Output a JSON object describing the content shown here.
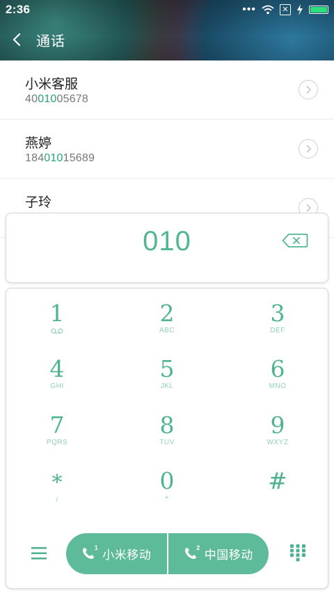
{
  "status_bar": {
    "time": "2:36",
    "battery_level": 1.0
  },
  "header": {
    "title": "通话"
  },
  "contacts": [
    {
      "name": "小米客服",
      "number_pre": "40",
      "number_match": "010",
      "number_post": "05678"
    },
    {
      "name": "燕婷",
      "number_pre": "184",
      "number_match": "010",
      "number_post": "15689"
    },
    {
      "name": "子玲",
      "number_pre": "",
      "number_match": "",
      "number_post": ""
    }
  ],
  "dialer": {
    "input_value": "010",
    "keys": [
      {
        "digit": "1",
        "sub": ""
      },
      {
        "digit": "2",
        "sub": "ABC"
      },
      {
        "digit": "3",
        "sub": "DEF"
      },
      {
        "digit": "4",
        "sub": "GHI"
      },
      {
        "digit": "5",
        "sub": "JKL"
      },
      {
        "digit": "6",
        "sub": "MNO"
      },
      {
        "digit": "7",
        "sub": "PQRS"
      },
      {
        "digit": "8",
        "sub": "TUV"
      },
      {
        "digit": "9",
        "sub": "WXYZ"
      },
      {
        "digit": "*",
        "sub": "/"
      },
      {
        "digit": "0",
        "sub": "+"
      },
      {
        "digit": "#",
        "sub": ""
      }
    ],
    "call_buttons": [
      {
        "sim": "1",
        "label": "小米移动"
      },
      {
        "sim": "2",
        "label": "中国移动"
      }
    ]
  },
  "colors": {
    "accent": "#52b594",
    "call_button": "#5dbb99",
    "match_highlight": "#27a37a"
  }
}
